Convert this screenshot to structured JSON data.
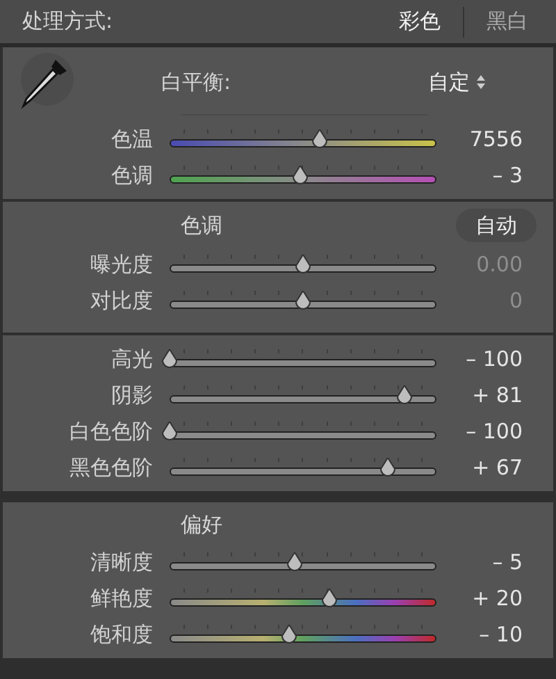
{
  "header": {
    "label": "处理方式:",
    "options": [
      {
        "label": "彩色",
        "selected": true
      },
      {
        "label": "黑白",
        "selected": false
      }
    ]
  },
  "white_balance": {
    "label": "白平衡:",
    "value": "自定",
    "sliders": [
      {
        "name": "色温",
        "kind": "temp",
        "level": 0.56,
        "reading": "7556",
        "dimmed": false
      },
      {
        "name": "色调",
        "kind": "tint",
        "level": 0.49,
        "reading": "– 3",
        "dimmed": false
      }
    ]
  },
  "tone": {
    "title": "色调",
    "auto_button": "自动",
    "sliders": [
      {
        "name": "曝光度",
        "kind": "plain",
        "level": 0.5,
        "reading": "0.00",
        "dimmed": true
      },
      {
        "name": "对比度",
        "kind": "plain",
        "level": 0.5,
        "reading": "0",
        "dimmed": true
      }
    ]
  },
  "tone_detail": {
    "sliders": [
      {
        "name": "高光",
        "kind": "plain",
        "level": 0.0,
        "reading": "– 100",
        "dimmed": false
      },
      {
        "name": "阴影",
        "kind": "plain",
        "level": 0.88,
        "reading": "+ 81",
        "dimmed": false
      },
      {
        "name": "白色色阶",
        "kind": "plain",
        "level": 0.0,
        "reading": "– 100",
        "dimmed": false
      },
      {
        "name": "黑色色阶",
        "kind": "plain",
        "level": 0.82,
        "reading": "+ 67",
        "dimmed": false
      }
    ]
  },
  "presence": {
    "title": "偏好",
    "sliders": [
      {
        "name": "清晰度",
        "kind": "plain",
        "level": 0.47,
        "reading": "– 5",
        "dimmed": false
      },
      {
        "name": "鲜艳度",
        "kind": "color",
        "level": 0.6,
        "reading": "+ 20",
        "dimmed": false
      },
      {
        "name": "饱和度",
        "kind": "color",
        "level": 0.45,
        "reading": "– 10",
        "dimmed": false
      }
    ]
  }
}
